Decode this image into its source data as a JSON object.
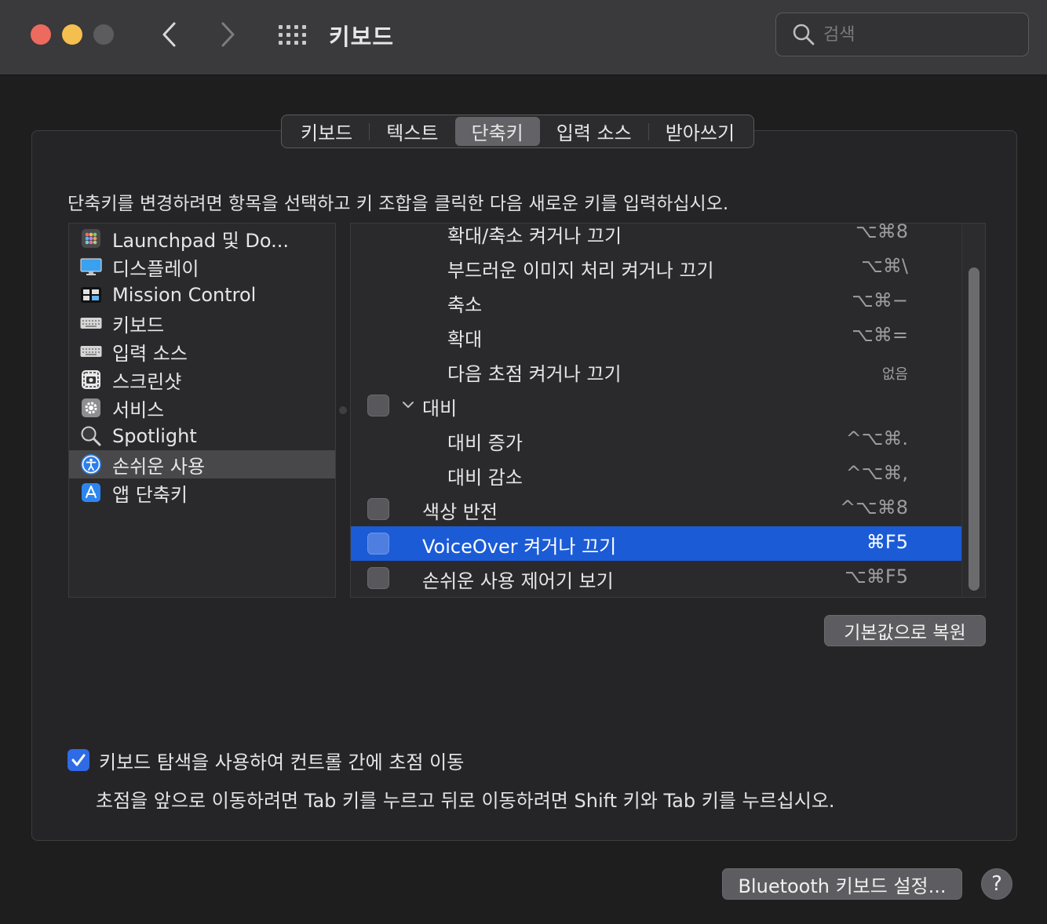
{
  "window": {
    "title": "키보드",
    "search_placeholder": "검색"
  },
  "tabs": [
    {
      "label": "키보드",
      "active": false
    },
    {
      "label": "텍스트",
      "active": false
    },
    {
      "label": "단축키",
      "active": true
    },
    {
      "label": "입력 소스",
      "active": false
    },
    {
      "label": "받아쓰기",
      "active": false
    }
  ],
  "instruction": "단축키를 변경하려면 항목을 선택하고 키 조합을 클릭한 다음 새로운 키를 입력하십시오.",
  "categories": [
    {
      "label": "Launchpad 및 Do...",
      "icon": "launchpad-icon",
      "selected": false
    },
    {
      "label": "디스플레이",
      "icon": "display-icon",
      "selected": false
    },
    {
      "label": "Mission Control",
      "icon": "mission-control-icon",
      "selected": false
    },
    {
      "label": "키보드",
      "icon": "keyboard-icon",
      "selected": false
    },
    {
      "label": "입력 소스",
      "icon": "keyboard-icon",
      "selected": false
    },
    {
      "label": "스크린샷",
      "icon": "screenshot-icon",
      "selected": false
    },
    {
      "label": "서비스",
      "icon": "gear-icon",
      "selected": false
    },
    {
      "label": "Spotlight",
      "icon": "magnifier-icon",
      "selected": false
    },
    {
      "label": "손쉬운 사용",
      "icon": "accessibility-icon",
      "selected": true
    },
    {
      "label": "앱 단축키",
      "icon": "app-store-icon",
      "selected": false
    }
  ],
  "shortcuts": [
    {
      "name": "확대/축소 켜거나 끄기",
      "key": "⌥⌘8",
      "checkbox": false,
      "indent": 2
    },
    {
      "name": "부드러운 이미지 처리 켜거나 끄기",
      "key": "⌥⌘\\",
      "checkbox": false,
      "indent": 2
    },
    {
      "name": "축소",
      "key": "⌥⌘−",
      "checkbox": false,
      "indent": 2
    },
    {
      "name": "확대",
      "key": "⌥⌘=",
      "checkbox": false,
      "indent": 2
    },
    {
      "name": "다음 초점 켜거나 끄기",
      "key": "없음",
      "checkbox": false,
      "indent": 2
    },
    {
      "name": "대비",
      "key": "",
      "checkbox": true,
      "indent": 1,
      "expandable": true
    },
    {
      "name": "대비 증가",
      "key": "^⌥⌘.",
      "checkbox": false,
      "indent": 2
    },
    {
      "name": "대비 감소",
      "key": "^⌥⌘,",
      "checkbox": false,
      "indent": 2
    },
    {
      "name": "색상 반전",
      "key": "^⌥⌘8",
      "checkbox": true,
      "indent": 1
    },
    {
      "name": "VoiceOver 켜거나 끄기",
      "key": "⌘F5",
      "checkbox": true,
      "indent": 1,
      "selected": true
    },
    {
      "name": "손쉬운 사용 제어기 보기",
      "key": "⌥⌘F5",
      "checkbox": true,
      "indent": 1
    }
  ],
  "restore_button": "기본값으로 복원",
  "keyboard_nav": {
    "checked": true,
    "label": "키보드 탐색을 사용하여 컨트롤 간에 초점 이동",
    "description": "초점을 앞으로 이동하려면 Tab 키를 누르고 뒤로 이동하려면 Shift 키와 Tab 키를 누르십시오."
  },
  "bluetooth_button": "Bluetooth 키보드 설정...",
  "help_button": "?",
  "colors": {
    "accent": "#1b5bd6",
    "checkbox_checked": "#2f6be6",
    "close": "#ed6a5e",
    "minimize": "#f5bf4f"
  }
}
